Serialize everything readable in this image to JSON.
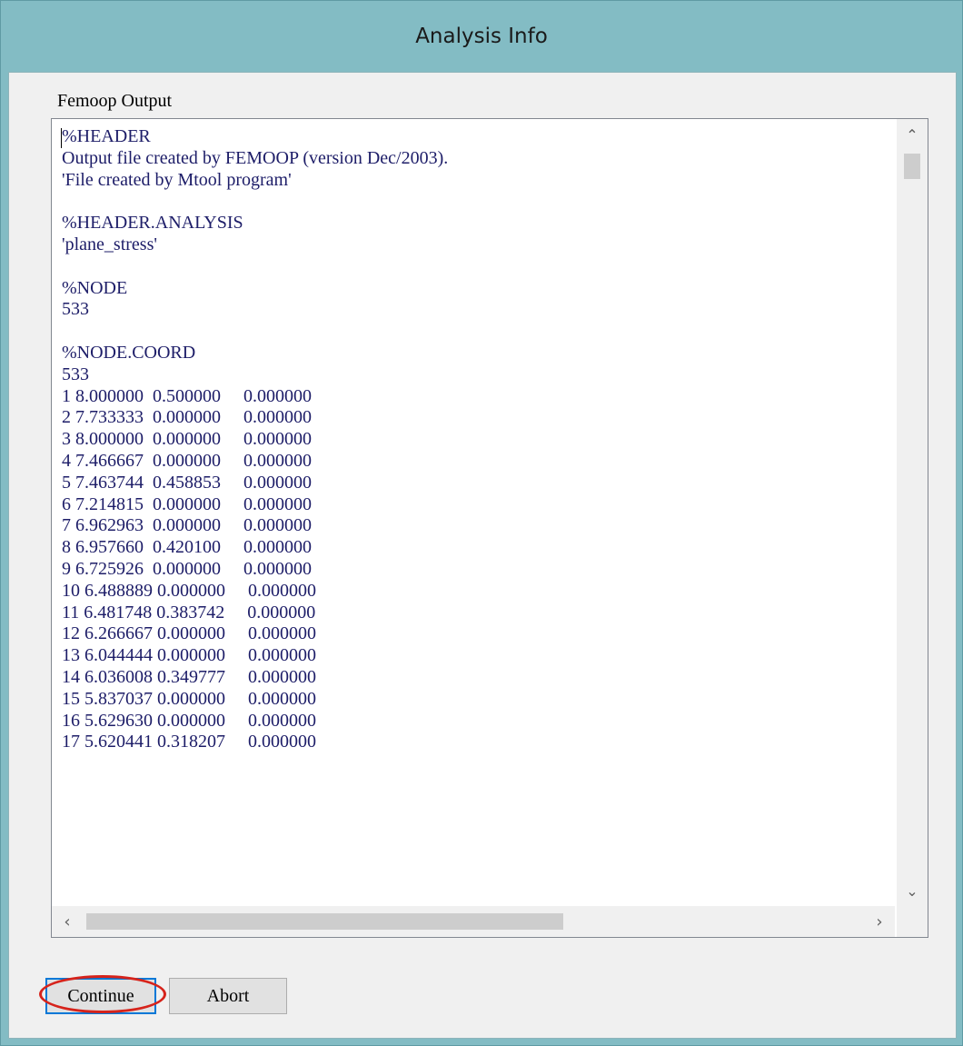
{
  "window": {
    "title": "Analysis Info"
  },
  "output": {
    "label": "Femoop Output",
    "lines": [
      "%HEADER",
      "Output file created by FEMOOP (version Dec/2003).",
      "'File created by Mtool program'",
      "",
      "%HEADER.ANALYSIS",
      "'plane_stress'",
      "",
      "%NODE",
      "533",
      "",
      "%NODE.COORD",
      "533",
      "1 8.000000  0.500000     0.000000",
      "2 7.733333  0.000000     0.000000",
      "3 8.000000  0.000000     0.000000",
      "4 7.466667  0.000000     0.000000",
      "5 7.463744  0.458853     0.000000",
      "6 7.214815  0.000000     0.000000",
      "7 6.962963  0.000000     0.000000",
      "8 6.957660  0.420100     0.000000",
      "9 6.725926  0.000000     0.000000",
      "10 6.488889 0.000000     0.000000",
      "11 6.481748 0.383742     0.000000",
      "12 6.266667 0.000000     0.000000",
      "13 6.044444 0.000000     0.000000",
      "14 6.036008 0.349777     0.000000",
      "15 5.837037 0.000000     0.000000",
      "16 5.629630 0.000000     0.000000",
      "17 5.620441 0.318207     0.000000"
    ]
  },
  "buttons": {
    "continue_label": "Continue",
    "abort_label": "Abort"
  },
  "scrollbars": {
    "up_icon": "chevron-up",
    "down_icon": "chevron-down",
    "left_icon": "chevron-left",
    "right_icon": "chevron-right"
  },
  "colors": {
    "titlebar": "#83bcc4",
    "text": "#1d1d68",
    "highlight": "#d6231b"
  }
}
